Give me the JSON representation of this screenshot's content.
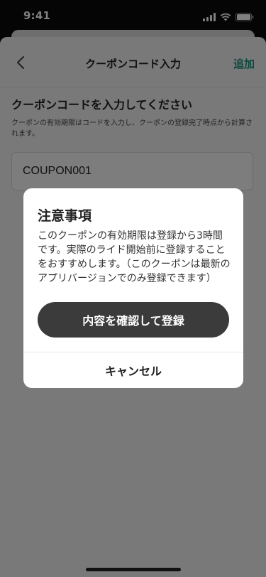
{
  "status_bar": {
    "time": "9:41",
    "icons": [
      "signal-icon",
      "wifi-icon",
      "battery-icon"
    ]
  },
  "nav": {
    "title": "クーポンコード入力",
    "add_label": "追加",
    "accent_color": "#1a8f7a"
  },
  "content": {
    "title": "クーポンコードを入力してください",
    "description": "クーポンの有効期限はコードを入力し、クーポンの登録完了時点から計算されます。",
    "coupon_input_value": "COUPON001"
  },
  "dialog": {
    "title": "注意事項",
    "body": "このクーポンの有効期限は登録から3時間です。実際のライド開始前に登録することをおすすめします。（このクーポンは最新のアプリバージョンでのみ登録できます）",
    "confirm_label": "内容を確認して登録",
    "cancel_label": "キャンセル"
  }
}
